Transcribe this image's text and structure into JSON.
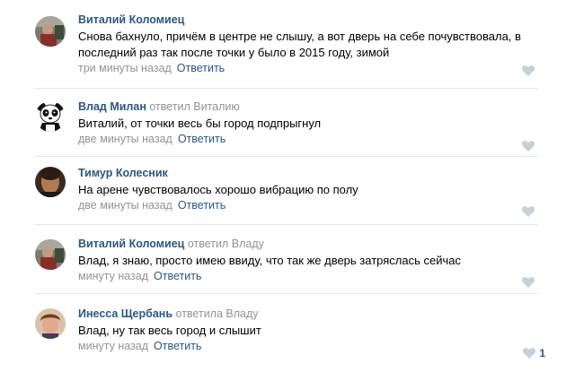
{
  "comments": [
    {
      "author": "Виталий Коломиец",
      "reply_to": "",
      "text": "Снова бахнуло, причём в центре не слышу, а вот дверь на себе почувствовала, в последний раз так после точки у было в 2015 году, зимой",
      "time": "три минуты назад",
      "reply_label": "Ответить",
      "likes": "",
      "avatar_icon": "user-photo"
    },
    {
      "author": "Влад Милан",
      "reply_to": "ответил Виталию",
      "text": "Виталий, от точки весь бы город подпрыгнул",
      "time": "две минуты назад",
      "reply_label": "Ответить",
      "likes": "",
      "avatar_icon": "panda-avatar"
    },
    {
      "author": "Тимур Колесник",
      "reply_to": "",
      "text": "На арене чувствовалось хорошо вибрацию по полу",
      "time": "две минуты назад",
      "reply_label": "Ответить",
      "likes": "",
      "avatar_icon": "user-photo"
    },
    {
      "author": "Виталий Коломиец",
      "reply_to": "ответил Владу",
      "text": "Влад, я знаю, просто имею ввиду, что так же дверь затряслась сейчас",
      "time": "минуту назад",
      "reply_label": "Ответить",
      "likes": "",
      "avatar_icon": "user-photo"
    },
    {
      "author": "Инесса Щербань",
      "reply_to": "ответила Владу",
      "text": "Влад, ну так весь город и слышит",
      "time": "минуту назад",
      "reply_label": "Ответить",
      "likes": "1",
      "avatar_icon": "user-photo"
    }
  ],
  "colors": {
    "link": "#2a5885",
    "muted": "#939393",
    "heart": "#c5d0db",
    "divider": "#e7e8ec"
  }
}
